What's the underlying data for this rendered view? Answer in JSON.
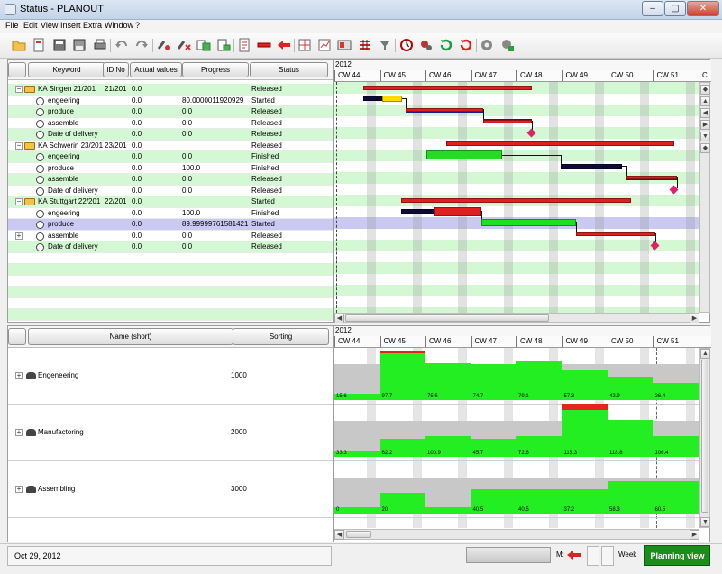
{
  "window": {
    "title": "Status - PLANOUT",
    "min": "–",
    "max": "▢",
    "close": "✕"
  },
  "menu": [
    "File",
    "Edit",
    "View",
    "Insert",
    "Extra",
    "Window",
    "?"
  ],
  "toolbar_icons": [
    "open-icon",
    "new-icon",
    "save-icon",
    "save-as-icon",
    "print-icon",
    "undo-icon",
    "redo-icon",
    "link-icon",
    "unlink-icon",
    "copy-icon",
    "paste-icon",
    "document-icon",
    "bar-icon",
    "arrow-left-icon",
    "grid-icon",
    "chart-icon",
    "layout-icon",
    "split-icon",
    "filter-icon",
    "clock-icon",
    "gears-icon",
    "refresh-icon",
    "reload-icon",
    "settings-icon",
    "plugin-icon"
  ],
  "orders": {
    "headers": [
      "Keyword",
      "ID No",
      "Actual values",
      "Progress",
      "Status"
    ],
    "rows": [
      {
        "keyword": "KA Singen 21/201",
        "id": "21/201",
        "actual": "0.0",
        "progress": "",
        "status": "Released",
        "level": 0,
        "group": true
      },
      {
        "keyword": "engeering",
        "id": "",
        "actual": "0.0",
        "progress": "80.0000011920929",
        "status": "Started",
        "level": 1
      },
      {
        "keyword": "produce",
        "id": "",
        "actual": "0.0",
        "progress": "0.0",
        "status": "Released",
        "level": 1
      },
      {
        "keyword": "assemble",
        "id": "",
        "actual": "0.0",
        "progress": "0.0",
        "status": "Released",
        "level": 1
      },
      {
        "keyword": "Date of delivery",
        "id": "",
        "actual": "0.0",
        "progress": "0.0",
        "status": "Released",
        "level": 1
      },
      {
        "keyword": "KA Schwerin 23/201",
        "id": "23/201",
        "actual": "0.0",
        "progress": "",
        "status": "Released",
        "level": 0,
        "group": true
      },
      {
        "keyword": "engeering",
        "id": "",
        "actual": "0.0",
        "progress": "0.0",
        "status": "Finished",
        "level": 1
      },
      {
        "keyword": "produce",
        "id": "",
        "actual": "0.0",
        "progress": "100.0",
        "status": "Finished",
        "level": 1
      },
      {
        "keyword": "assemble",
        "id": "",
        "actual": "0.0",
        "progress": "0.0",
        "status": "Released",
        "level": 1
      },
      {
        "keyword": "Date of delivery",
        "id": "",
        "actual": "0.0",
        "progress": "0.0",
        "status": "Released",
        "level": 1
      },
      {
        "keyword": "KA Stuttgart 22/201",
        "id": "22/201",
        "actual": "0.0",
        "progress": "",
        "status": "Started",
        "level": 0,
        "group": true
      },
      {
        "keyword": "engeering",
        "id": "",
        "actual": "0.0",
        "progress": "100.0",
        "status": "Finished",
        "level": 1
      },
      {
        "keyword": "produce",
        "id": "",
        "actual": "0.0",
        "progress": "89.99999761581421",
        "status": "Started",
        "level": 1,
        "selected": true
      },
      {
        "keyword": "assemble",
        "id": "",
        "actual": "0.0",
        "progress": "0.0",
        "status": "Released",
        "level": 1,
        "collapsed": true
      },
      {
        "keyword": "Date of delivery",
        "id": "",
        "actual": "0.0",
        "progress": "0.0",
        "status": "Released",
        "level": 1
      }
    ]
  },
  "gantt": {
    "year": "2012",
    "weeks": [
      "CW 44",
      "CW 45",
      "CW 46",
      "CW 47",
      "CW 48",
      "CW 49",
      "CW 50",
      "CW 51",
      "C"
    ],
    "colors": {
      "planned": "#e02020",
      "progress": "#ffd800",
      "done": "#0b0b3a",
      "finished": "#22dd22",
      "released": "#2a2ad0"
    }
  },
  "resources": {
    "headers": [
      "Name (short)",
      "Sorting"
    ],
    "rows": [
      {
        "name": "Engeneering",
        "sorting": "1000"
      },
      {
        "name": "Manufactoring",
        "sorting": "2000"
      },
      {
        "name": "Assembling",
        "sorting": "3000"
      }
    ]
  },
  "load": {
    "year": "2012",
    "weeks": [
      "CW 44",
      "CW 45",
      "CW 46",
      "CW 47",
      "CW 48",
      "CW 49",
      "CW 50",
      "CW 51"
    ],
    "rows": [
      [
        {
          "label": "15.6",
          "level": 0.0
        },
        {
          "label": "97.7",
          "level": 1.04
        },
        {
          "label": "75.6",
          "level": 0.75
        },
        {
          "label": "74.7",
          "level": 0.74
        },
        {
          "label": "79.1",
          "level": 0.79
        },
        {
          "label": "57.3",
          "level": 0.57
        },
        {
          "label": "42.9",
          "level": 0.43
        },
        {
          "label": "26.4",
          "level": 0.26
        }
      ],
      [
        {
          "label": "33.3",
          "level": 0.0
        },
        {
          "label": "62.2",
          "level": 0.3
        },
        {
          "label": "100.9",
          "level": 0.35
        },
        {
          "label": "45.7",
          "level": 0.3
        },
        {
          "label": "72.6",
          "level": 0.35
        },
        {
          "label": "115.3",
          "level": 1.15
        },
        {
          "label": "118.8",
          "level": 0.75
        },
        {
          "label": "106.4",
          "level": 0.35
        }
      ],
      [
        {
          "label": "0",
          "level": 0.0
        },
        {
          "label": "20",
          "level": 0.35
        },
        {
          "label": "",
          "level": 0.0
        },
        {
          "label": "40.5",
          "level": 0.45
        },
        {
          "label": "40.5",
          "level": 0.45
        },
        {
          "label": "37.2",
          "level": 0.45
        },
        {
          "label": "58.3",
          "level": 0.65
        },
        {
          "label": "60.5",
          "level": 0.65
        }
      ]
    ]
  },
  "statusbar": {
    "date": "Oct 29, 2012",
    "m_label": "M:",
    "scale": "Week",
    "view": "Planning view"
  }
}
